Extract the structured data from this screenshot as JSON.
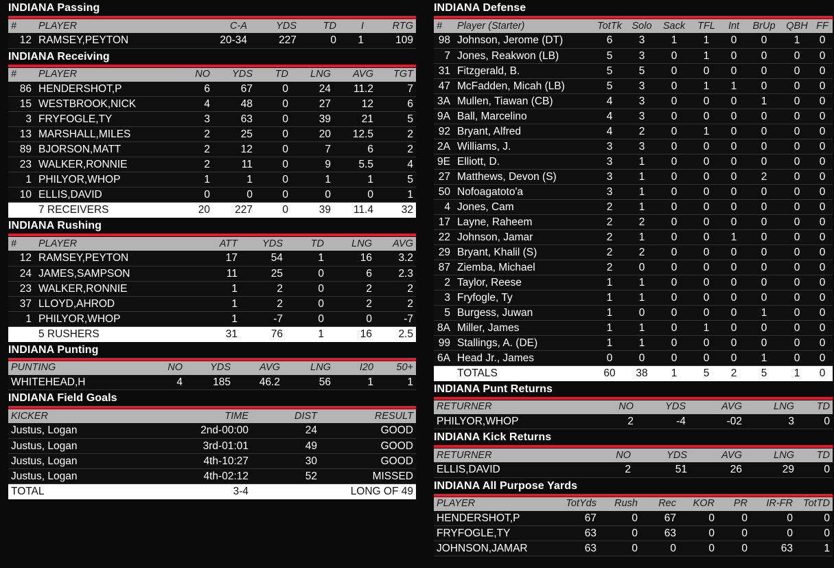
{
  "sections": {
    "passing": {
      "title": "INDIANA Passing",
      "headers": [
        "#",
        "PLAYER",
        "C-A",
        "YDS",
        "TD",
        "I",
        "RTG"
      ],
      "rows": [
        {
          "num": "12",
          "player": "RAMSEY,PEYTON",
          "ca": "20-34",
          "yds": "227",
          "td": "0",
          "i": "1",
          "rtg": "109"
        }
      ]
    },
    "receiving": {
      "title": "INDIANA Receiving",
      "headers": [
        "#",
        "PLAYER",
        "NO",
        "YDS",
        "TD",
        "LNG",
        "AVG",
        "TGT"
      ],
      "rows": [
        {
          "num": "86",
          "player": "HENDERSHOT,P",
          "no": "6",
          "yds": "67",
          "td": "0",
          "lng": "24",
          "avg": "11.2",
          "tgt": "7"
        },
        {
          "num": "15",
          "player": "WESTBROOK,NICK",
          "no": "4",
          "yds": "48",
          "td": "0",
          "lng": "27",
          "avg": "12",
          "tgt": "6"
        },
        {
          "num": "3",
          "player": "FRYFOGLE,TY",
          "no": "3",
          "yds": "63",
          "td": "0",
          "lng": "39",
          "avg": "21",
          "tgt": "5"
        },
        {
          "num": "13",
          "player": "MARSHALL,MILES",
          "no": "2",
          "yds": "25",
          "td": "0",
          "lng": "20",
          "avg": "12.5",
          "tgt": "2"
        },
        {
          "num": "89",
          "player": "BJORSON,MATT",
          "no": "2",
          "yds": "12",
          "td": "0",
          "lng": "7",
          "avg": "6",
          "tgt": "2"
        },
        {
          "num": "23",
          "player": "WALKER,RONNIE",
          "no": "2",
          "yds": "11",
          "td": "0",
          "lng": "9",
          "avg": "5.5",
          "tgt": "4"
        },
        {
          "num": "1",
          "player": "PHILYOR,WHOP",
          "no": "1",
          "yds": "1",
          "td": "0",
          "lng": "1",
          "avg": "1",
          "tgt": "5"
        },
        {
          "num": "10",
          "player": "ELLIS,DAVID",
          "no": "0",
          "yds": "0",
          "td": "0",
          "lng": "0",
          "avg": "0",
          "tgt": "1"
        }
      ],
      "total": {
        "num": "",
        "player": "7 RECEIVERS",
        "no": "20",
        "yds": "227",
        "td": "0",
        "lng": "39",
        "avg": "11.4",
        "tgt": "32"
      }
    },
    "rushing": {
      "title": "INDIANA Rushing",
      "headers": [
        "#",
        "PLAYER",
        "ATT",
        "YDS",
        "TD",
        "LNG",
        "AVG"
      ],
      "rows": [
        {
          "num": "12",
          "player": "RAMSEY,PEYTON",
          "att": "17",
          "yds": "54",
          "td": "1",
          "lng": "16",
          "avg": "3.2"
        },
        {
          "num": "24",
          "player": "JAMES,SAMPSON",
          "att": "11",
          "yds": "25",
          "td": "0",
          "lng": "6",
          "avg": "2.3"
        },
        {
          "num": "23",
          "player": "WALKER,RONNIE",
          "att": "1",
          "yds": "2",
          "td": "0",
          "lng": "2",
          "avg": "2"
        },
        {
          "num": "37",
          "player": "LLOYD,AHROD",
          "att": "1",
          "yds": "2",
          "td": "0",
          "lng": "2",
          "avg": "2"
        },
        {
          "num": "1",
          "player": "PHILYOR,WHOP",
          "att": "1",
          "yds": "-7",
          "td": "0",
          "lng": "0",
          "avg": "-7"
        }
      ],
      "total": {
        "num": "",
        "player": "5 RUSHERS",
        "att": "31",
        "yds": "76",
        "td": "1",
        "lng": "16",
        "avg": "2.5"
      }
    },
    "punting": {
      "title": "INDIANA Punting",
      "headers": [
        "PUNTING",
        "NO",
        "YDS",
        "AVG",
        "LNG",
        "I20",
        "50+"
      ],
      "rows": [
        {
          "player": "WHITEHEAD,H",
          "no": "4",
          "yds": "185",
          "avg": "46.2",
          "lng": "56",
          "i20": "1",
          "fifty": "1"
        }
      ]
    },
    "field_goals": {
      "title": "INDIANA Field Goals",
      "headers": [
        "KICKER",
        "TIME",
        "DIST",
        "RESULT"
      ],
      "rows": [
        {
          "kicker": "Justus, Logan",
          "time": "2nd-00:00",
          "dist": "24",
          "result": "GOOD"
        },
        {
          "kicker": "Justus, Logan",
          "time": "3rd-01:01",
          "dist": "49",
          "result": "GOOD"
        },
        {
          "kicker": "Justus, Logan",
          "time": "4th-10:27",
          "dist": "30",
          "result": "GOOD"
        },
        {
          "kicker": "Justus, Logan",
          "time": "4th-02:12",
          "dist": "52",
          "result": "MISSED"
        }
      ],
      "total": {
        "kicker": "TOTAL",
        "time": "3-4",
        "dist": "",
        "result": "LONG OF 49"
      }
    },
    "defense": {
      "title": "INDIANA Defense",
      "headers": [
        "#",
        "Player (Starter)",
        "TotTk",
        "Solo",
        "Sack",
        "TFL",
        "Int",
        "BrUp",
        "QBH",
        "FF"
      ],
      "rows": [
        {
          "num": "98",
          "player": "Johnson, Jerome (DT)",
          "tottk": "6",
          "solo": "3",
          "sack": "1",
          "tfl": "1",
          "int": "0",
          "brup": "0",
          "qbh": "1",
          "ff": "0"
        },
        {
          "num": "7",
          "player": "Jones, Reakwon (LB)",
          "tottk": "5",
          "solo": "3",
          "sack": "0",
          "tfl": "1",
          "int": "0",
          "brup": "0",
          "qbh": "0",
          "ff": "0"
        },
        {
          "num": "31",
          "player": "Fitzgerald, B.",
          "tottk": "5",
          "solo": "5",
          "sack": "0",
          "tfl": "0",
          "int": "0",
          "brup": "0",
          "qbh": "0",
          "ff": "0"
        },
        {
          "num": "47",
          "player": "McFadden, Micah (LB)",
          "tottk": "5",
          "solo": "3",
          "sack": "0",
          "tfl": "1",
          "int": "1",
          "brup": "0",
          "qbh": "0",
          "ff": "0"
        },
        {
          "num": "3A",
          "player": "Mullen, Tiawan (CB)",
          "tottk": "4",
          "solo": "3",
          "sack": "0",
          "tfl": "0",
          "int": "0",
          "brup": "1",
          "qbh": "0",
          "ff": "0"
        },
        {
          "num": "9A",
          "player": "Ball, Marcelino",
          "tottk": "4",
          "solo": "3",
          "sack": "0",
          "tfl": "0",
          "int": "0",
          "brup": "0",
          "qbh": "0",
          "ff": "0"
        },
        {
          "num": "92",
          "player": "Bryant, Alfred",
          "tottk": "4",
          "solo": "2",
          "sack": "0",
          "tfl": "1",
          "int": "0",
          "brup": "0",
          "qbh": "0",
          "ff": "0"
        },
        {
          "num": "2A",
          "player": "Williams, J.",
          "tottk": "3",
          "solo": "3",
          "sack": "0",
          "tfl": "0",
          "int": "0",
          "brup": "0",
          "qbh": "0",
          "ff": "0"
        },
        {
          "num": "9E",
          "player": "Elliott, D.",
          "tottk": "3",
          "solo": "1",
          "sack": "0",
          "tfl": "0",
          "int": "0",
          "brup": "0",
          "qbh": "0",
          "ff": "0"
        },
        {
          "num": "27",
          "player": "Matthews, Devon (S)",
          "tottk": "3",
          "solo": "1",
          "sack": "0",
          "tfl": "0",
          "int": "0",
          "brup": "2",
          "qbh": "0",
          "ff": "0"
        },
        {
          "num": "50",
          "player": "Nofoagatoto'a",
          "tottk": "3",
          "solo": "1",
          "sack": "0",
          "tfl": "0",
          "int": "0",
          "brup": "0",
          "qbh": "0",
          "ff": "0"
        },
        {
          "num": "4",
          "player": "Jones, Cam",
          "tottk": "2",
          "solo": "1",
          "sack": "0",
          "tfl": "0",
          "int": "0",
          "brup": "0",
          "qbh": "0",
          "ff": "0"
        },
        {
          "num": "17",
          "player": "Layne, Raheem",
          "tottk": "2",
          "solo": "2",
          "sack": "0",
          "tfl": "0",
          "int": "0",
          "brup": "0",
          "qbh": "0",
          "ff": "0"
        },
        {
          "num": "22",
          "player": "Johnson, Jamar",
          "tottk": "2",
          "solo": "1",
          "sack": "0",
          "tfl": "0",
          "int": "1",
          "brup": "0",
          "qbh": "0",
          "ff": "0"
        },
        {
          "num": "29",
          "player": "Bryant, Khalil (S)",
          "tottk": "2",
          "solo": "2",
          "sack": "0",
          "tfl": "0",
          "int": "0",
          "brup": "0",
          "qbh": "0",
          "ff": "0"
        },
        {
          "num": "87",
          "player": "Ziemba, Michael",
          "tottk": "2",
          "solo": "0",
          "sack": "0",
          "tfl": "0",
          "int": "0",
          "brup": "0",
          "qbh": "0",
          "ff": "0"
        },
        {
          "num": "2",
          "player": "Taylor, Reese",
          "tottk": "1",
          "solo": "1",
          "sack": "0",
          "tfl": "0",
          "int": "0",
          "brup": "0",
          "qbh": "0",
          "ff": "0"
        },
        {
          "num": "3",
          "player": "Fryfogle, Ty",
          "tottk": "1",
          "solo": "1",
          "sack": "0",
          "tfl": "0",
          "int": "0",
          "brup": "0",
          "qbh": "0",
          "ff": "0"
        },
        {
          "num": "5",
          "player": "Burgess, Juwan",
          "tottk": "1",
          "solo": "0",
          "sack": "0",
          "tfl": "0",
          "int": "0",
          "brup": "1",
          "qbh": "0",
          "ff": "0"
        },
        {
          "num": "8A",
          "player": "Miller, James",
          "tottk": "1",
          "solo": "1",
          "sack": "0",
          "tfl": "1",
          "int": "0",
          "brup": "0",
          "qbh": "0",
          "ff": "0"
        },
        {
          "num": "99",
          "player": "Stallings, A. (DE)",
          "tottk": "1",
          "solo": "1",
          "sack": "0",
          "tfl": "0",
          "int": "0",
          "brup": "0",
          "qbh": "0",
          "ff": "0"
        },
        {
          "num": "6A",
          "player": "Head Jr., James",
          "tottk": "0",
          "solo": "0",
          "sack": "0",
          "tfl": "0",
          "int": "0",
          "brup": "1",
          "qbh": "0",
          "ff": "0"
        }
      ],
      "total": {
        "num": "",
        "player": "TOTALS",
        "tottk": "60",
        "solo": "38",
        "sack": "1",
        "tfl": "5",
        "int": "2",
        "brup": "5",
        "qbh": "1",
        "ff": "0"
      }
    },
    "punt_returns": {
      "title": "INDIANA Punt Returns",
      "headers": [
        "RETURNER",
        "NO",
        "YDS",
        "AVG",
        "LNG",
        "TD"
      ],
      "rows": [
        {
          "returner": "PHILYOR,WHOP",
          "no": "2",
          "yds": "-4",
          "avg": "-02",
          "lng": "3",
          "td": "0"
        }
      ]
    },
    "kick_returns": {
      "title": "INDIANA Kick Returns",
      "headers": [
        "RETURNER",
        "NO",
        "YDS",
        "AVG",
        "LNG",
        "TD"
      ],
      "rows": [
        {
          "returner": "ELLIS,DAVID",
          "no": "2",
          "yds": "51",
          "avg": "26",
          "lng": "29",
          "td": "0"
        }
      ]
    },
    "all_purpose": {
      "title": "INDIANA All Purpose Yards",
      "headers": [
        "PLAYER",
        "TotYds",
        "Rush",
        "Rec",
        "KOR",
        "PR",
        "IR-FR",
        "TotTD"
      ],
      "rows": [
        {
          "player": "HENDERSHOT,P",
          "totyds": "67",
          "rush": "0",
          "rec": "67",
          "kor": "0",
          "pr": "0",
          "irfr": "0",
          "tottd": "0"
        },
        {
          "player": "FRYFOGLE,TY",
          "totyds": "63",
          "rush": "0",
          "rec": "63",
          "kor": "0",
          "pr": "0",
          "irfr": "0",
          "tottd": "0"
        },
        {
          "player": "JOHNSON,JAMAR",
          "totyds": "63",
          "rush": "0",
          "rec": "0",
          "kor": "0",
          "pr": "0",
          "irfr": "63",
          "tottd": "1"
        }
      ]
    }
  },
  "colors": {
    "accent": "#e8192c",
    "header_bg": "#b4b4b4",
    "page_bg": "#0b0b0b",
    "row_bg": "#0f0f0f",
    "total_bg": "#ffffff"
  }
}
